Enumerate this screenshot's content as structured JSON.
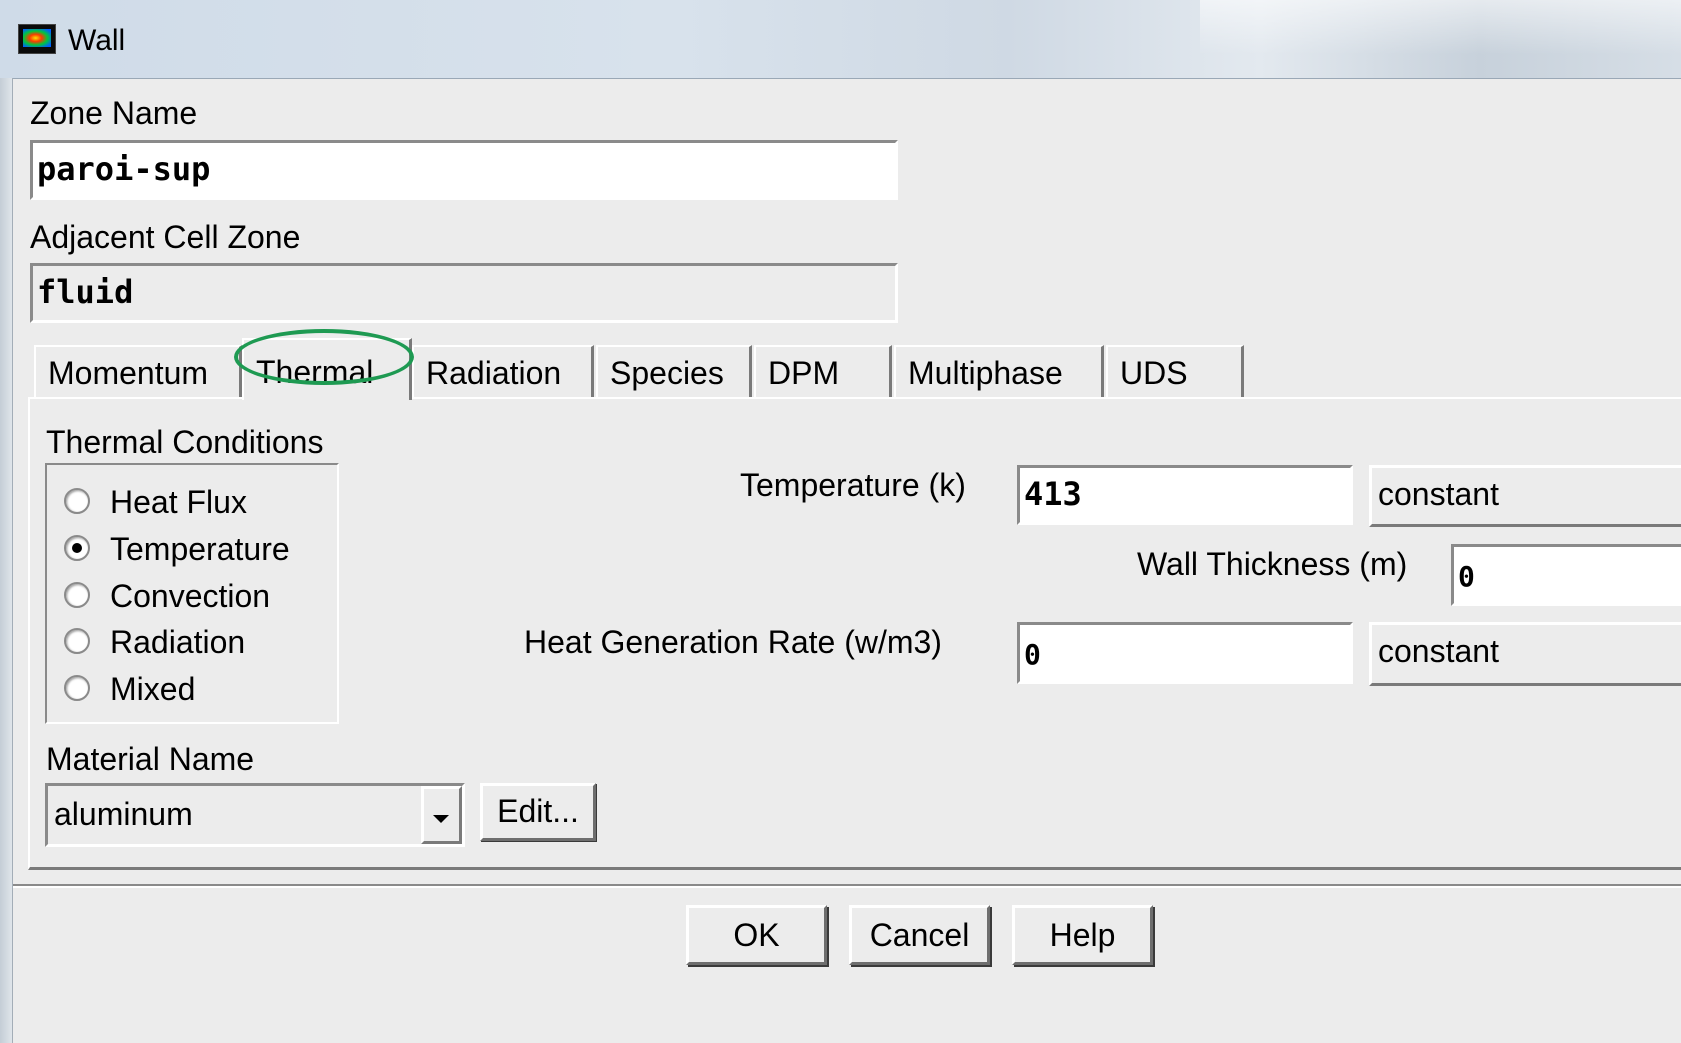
{
  "window": {
    "title": "Wall",
    "icon": "fluent-app-icon"
  },
  "zone_name": {
    "label": "Zone Name",
    "value": "paroi-sup"
  },
  "adjacent_cell_zone": {
    "label": "Adjacent Cell Zone",
    "value": "fluid"
  },
  "tabs": [
    {
      "label": "Momentum"
    },
    {
      "label": "Thermal"
    },
    {
      "label": "Radiation"
    },
    {
      "label": "Species"
    },
    {
      "label": "DPM"
    },
    {
      "label": "Multiphase"
    },
    {
      "label": "UDS"
    }
  ],
  "active_tab": "Thermal",
  "thermal": {
    "conditions_label": "Thermal Conditions",
    "options": [
      "Heat Flux",
      "Temperature",
      "Convection",
      "Radiation",
      "Mixed"
    ],
    "selected": "Temperature",
    "temperature": {
      "label": "Temperature (k)",
      "value": "413",
      "profile": "constant"
    },
    "wall_thickness": {
      "label": "Wall Thickness (m)",
      "value": "0"
    },
    "heat_generation": {
      "label": "Heat Generation Rate (w/m3)",
      "value": "0",
      "profile": "constant"
    },
    "material": {
      "label": "Material Name",
      "value": "aluminum",
      "edit_label": "Edit..."
    }
  },
  "buttons": {
    "ok": "OK",
    "cancel": "Cancel",
    "help": "Help"
  },
  "annotation_color": "#1e9a52"
}
